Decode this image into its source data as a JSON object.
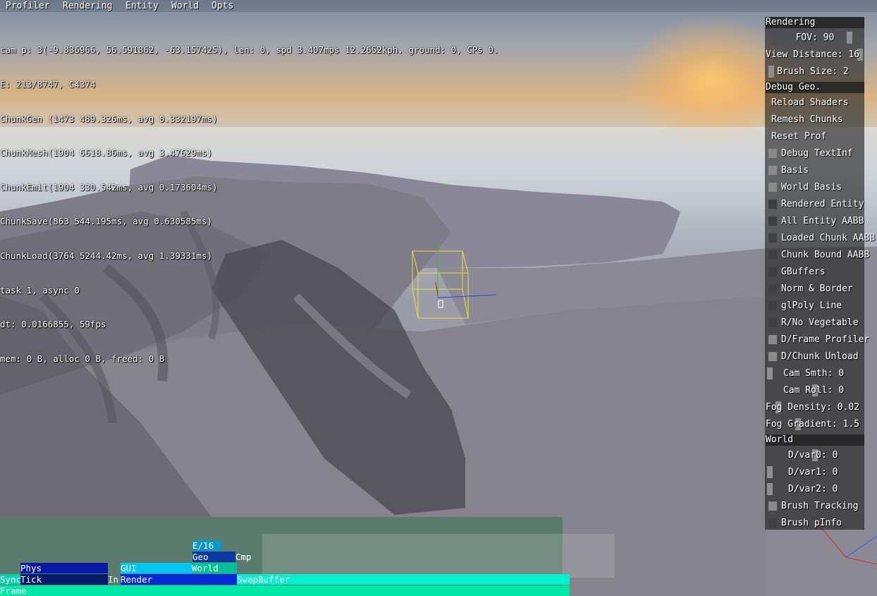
{
  "menubar": {
    "items": [
      "Profiler",
      "Rendering",
      "Entity",
      "World",
      "Opts"
    ]
  },
  "hud": {
    "lines": [
      "cam p: 3(-9.836966, 56.591862, -63.157425), len: 0, spd 3.407mps 12.2652kph. ground: 0, CPs 0.",
      "E: 213/8747, C4374",
      "ChunkGen (1473 489.326ms, avg 0.332197ms)",
      "ChunkMesh(1904 6618.86ms, avg 3.47629ms)",
      "ChunkEmit(1904 330.542ms, avg 0.173604ms)",
      "ChunkSave(863 544.195ms, avg 0.630585ms)",
      "ChunkLoad(3764 5244.42ms, avg 1.39331ms)",
      "task 1, async 0",
      "dt: 0.0166855, 59fps",
      "mem: 0 B, alloc 0 B, freed: 0 B"
    ]
  },
  "panel": {
    "rendering_header": "Rendering",
    "fov": "FOV: 90",
    "view_distance": "View Distance: 16",
    "brush_size": "Brush Size: 2",
    "debug_geo_header": "Debug Geo.",
    "reload_shaders": "Reload Shaders",
    "remesh_chunks": "Remesh Chunks",
    "reset_prof": "Reset Prof",
    "checkboxes": [
      {
        "label": "Debug TextInf",
        "checked": true
      },
      {
        "label": "Basis",
        "checked": true
      },
      {
        "label": "World Basis",
        "checked": true
      },
      {
        "label": "Rendered Entity",
        "checked": false
      },
      {
        "label": "All Entity AABB",
        "checked": false
      },
      {
        "label": "Loaded Chunk AABB",
        "checked": false
      },
      {
        "label": "Chunk Bound AABB",
        "checked": false
      },
      {
        "label": "GBuffers",
        "checked": false
      },
      {
        "label": "Norm & Border",
        "checked": false
      },
      {
        "label": "glPoly Line",
        "checked": false
      },
      {
        "label": "R/No Vegetable",
        "checked": false
      },
      {
        "label": "D/Frame Profiler",
        "checked": true
      },
      {
        "label": "D/Chunk Unload",
        "checked": true
      }
    ],
    "cam_smth": "Cam Smth: 0",
    "cam_roll": "Cam Roll: 0",
    "fog_density": "Fog Density: 0.02",
    "fog_gradient": "Fog Gradient: 1.5",
    "world_header": "World",
    "dvar0": "D/var0: 0",
    "dvar1": "D/var1: 0",
    "dvar2": "D/var2: 0",
    "brush_tracking": {
      "label": "Brush Tracking",
      "checked": true
    },
    "brush_pinfo": {
      "label": "Brush pInfo",
      "checked": false
    }
  },
  "profiler": {
    "e16": "E/16",
    "geo": "Geo",
    "cmp": "Cmp",
    "phys": "Phys",
    "gui": "GUI",
    "world": "World",
    "sync": "Sync",
    "tick": "Tick",
    "in": "In",
    "render": "Render",
    "swapbuffer": "SwapBuffer",
    "frame": "Frame"
  },
  "colors": {
    "frame": "#00e8a8",
    "swap": "#00f0d0",
    "render": "#0a2ad8",
    "tick": "#041a6a",
    "gui": "#00c8f0",
    "world": "#00c09a",
    "geo": "#0a3aa0",
    "e16": "#0898c8",
    "phys": "#0818a8",
    "gizmo": "#e8e040"
  }
}
